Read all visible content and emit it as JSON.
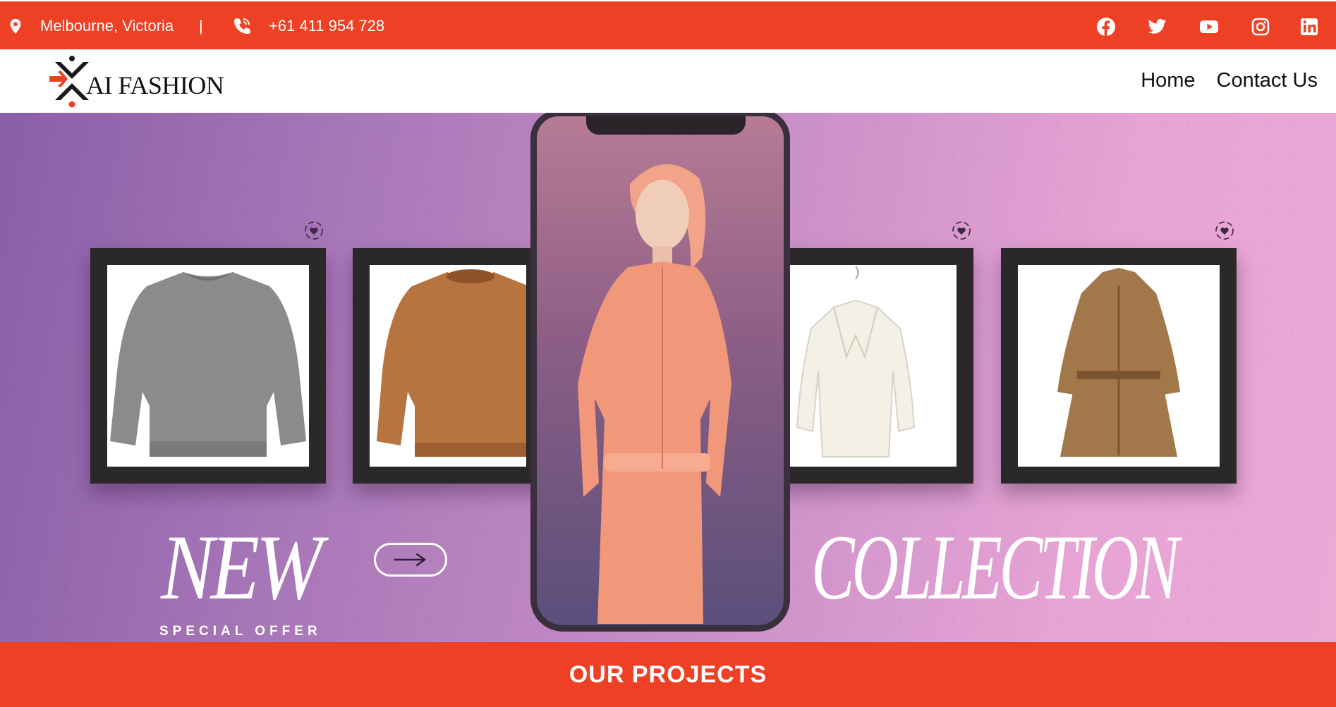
{
  "topbar": {
    "location": "Melbourne, Victoria",
    "separator": "|",
    "phone": "+61 411 954 728",
    "background": "#ee4025",
    "icons": [
      "map-pin-icon",
      "phone-icon"
    ],
    "social": [
      "facebook-icon",
      "twitter-icon",
      "youtube-icon",
      "instagram-icon",
      "linkedin-icon"
    ]
  },
  "header": {
    "logo_text": "AI FASHION",
    "nav": [
      "Home",
      "Contact Us"
    ]
  },
  "hero": {
    "headline_left": "NEW",
    "headline_right": "COLLECTION",
    "tagline": "SPECIAL OFFER",
    "products": [
      "grey-sweatshirt",
      "orange-sweater",
      "white-blazer",
      "brown-trench-coat"
    ],
    "colors": {
      "gradient_start": "#8a5ea8",
      "gradient_end": "#eba9d6"
    }
  },
  "section": {
    "title": "OUR PROJECTS"
  }
}
